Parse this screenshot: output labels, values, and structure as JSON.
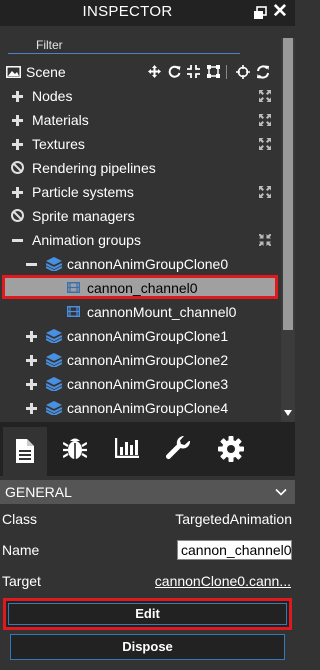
{
  "titlebar": {
    "title": "INSPECTOR"
  },
  "filter": {
    "placeholder": "Filter"
  },
  "tree": {
    "scene": "Scene",
    "nodes": "Nodes",
    "materials": "Materials",
    "textures": "Textures",
    "rendering_pipelines": "Rendering pipelines",
    "particle_systems": "Particle systems",
    "sprite_managers": "Sprite managers",
    "animation_groups": "Animation groups",
    "group_clone0": "cannonAnimGroupClone0",
    "channel0": "cannon_channel0",
    "mount_channel0": "cannonMount_channel0",
    "group_clone1": "cannonAnimGroupClone1",
    "group_clone2": "cannonAnimGroupClone2",
    "group_clone3": "cannonAnimGroupClone3",
    "group_clone4": "cannonAnimGroupClone4"
  },
  "tabs": [
    "file-icon",
    "bug-icon",
    "chart-icon",
    "wrench-icon",
    "gear-icon"
  ],
  "general": {
    "header": "GENERAL",
    "class_label": "Class",
    "class_value": "TargetedAnimation",
    "name_label": "Name",
    "name_value": "cannon_channel0",
    "target_label": "Target",
    "target_value": "cannonClone0.cann...",
    "edit": "Edit",
    "dispose": "Dispose"
  },
  "colors": {
    "highlight": "#e0191d",
    "accent": "#337ab7",
    "selected": "#a0a0a0",
    "icon_blue": "#4a90e2"
  }
}
